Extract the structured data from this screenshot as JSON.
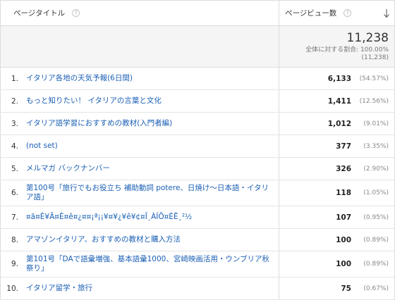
{
  "header": {
    "title_col": "ページタイトル",
    "views_col": "ページビュー数"
  },
  "summary": {
    "total": "11,238",
    "share_label": "全体に対する割合: 100.00%",
    "total_paren": "(11,238)"
  },
  "rows": [
    {
      "rank": "1.",
      "title": "イタリア各地の天気予報(6日間)",
      "views": "6,133",
      "pct": "(54.57%)"
    },
    {
      "rank": "2.",
      "title": "もっと知りたい！ イタリアの言葉と文化",
      "views": "1,411",
      "pct": "(12.56%)"
    },
    {
      "rank": "3.",
      "title": "イタリア語学習におすすめの教材(入門者編)",
      "views": "1,012",
      "pct": "(9.01%)"
    },
    {
      "rank": "4.",
      "title": "(not set)",
      "views": "377",
      "pct": "(3.35%)"
    },
    {
      "rank": "5.",
      "title": "メルマガ バックナンバー",
      "views": "326",
      "pct": "(2.90%)"
    },
    {
      "rank": "6.",
      "title": "第100号「旅行でもお役立ち 補助動詞 potere、日焼け～日本語・イタリア語」",
      "views": "118",
      "pct": "(1.05%)"
    },
    {
      "rank": "7.",
      "title": "¤ã¤È¥Ã¤È¤ê¤¿¤¤¡ª¡¡¥¤¥¿¥ê¥¢¤Î¸ÀÍÕ¤ÈÊ¸²½",
      "views": "107",
      "pct": "(0.95%)"
    },
    {
      "rank": "8.",
      "title": "アマゾンイタリア、おすすめの教材と購入方法",
      "views": "100",
      "pct": "(0.89%)"
    },
    {
      "rank": "9.",
      "title": "第101号「DAで語彙増強、基本語彙1000、宮崎映画活用・ウンブリア秋祭り」",
      "views": "100",
      "pct": "(0.89%)"
    },
    {
      "rank": "10.",
      "title": "イタリア留学・旅行",
      "views": "75",
      "pct": "(0.67%)"
    }
  ],
  "icons": {
    "help": "?"
  }
}
